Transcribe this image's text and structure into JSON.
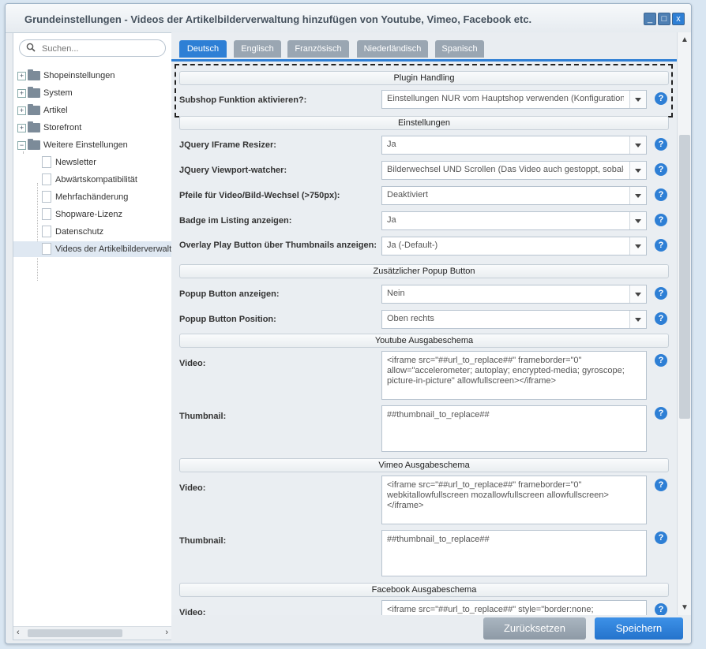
{
  "window": {
    "title": "Grundeinstellungen - Videos der Artikelbilderverwaltung hinzufügen von Youtube, Vimeo, Facebook etc.",
    "controls": {
      "minimize": "_",
      "maximize": "□",
      "close": "x"
    }
  },
  "sidebar": {
    "search_placeholder": "Suchen...",
    "tree": [
      {
        "label": "Shopeinstellungen",
        "type": "folder"
      },
      {
        "label": "System",
        "type": "folder"
      },
      {
        "label": "Artikel",
        "type": "folder"
      },
      {
        "label": "Storefront",
        "type": "folder"
      },
      {
        "label": "Weitere Einstellungen",
        "type": "folder-open"
      },
      {
        "label": "Newsletter",
        "type": "leaf"
      },
      {
        "label": "Abwärtskompatibilität",
        "type": "leaf"
      },
      {
        "label": "Mehrfachänderung",
        "type": "leaf"
      },
      {
        "label": "Shopware-Lizenz",
        "type": "leaf"
      },
      {
        "label": "Datenschutz",
        "type": "leaf"
      },
      {
        "label": "Videos der Artikelbilderverwaltung hinzufügen",
        "type": "leaf",
        "selected": true
      }
    ]
  },
  "tabs": [
    "Deutsch",
    "Englisch",
    "Französisch",
    "Niederländisch",
    "Spanisch"
  ],
  "form": {
    "sections": {
      "plugin_handling": "Plugin Handling",
      "settings": "Einstellungen",
      "popup": "Zusätzlicher Popup Button",
      "youtube": "Youtube Ausgabeschema",
      "vimeo": "Vimeo Ausgabeschema",
      "facebook": "Facebook Ausgabeschema"
    },
    "fields": {
      "subshop": {
        "label": "Subshop Funktion aktivieren?:",
        "value": "Einstellungen NUR vom Hauptshop verwenden (Konfigurationen"
      },
      "iframe_resizer": {
        "label": "JQuery IFrame Resizer:",
        "value": "Ja"
      },
      "viewport_watcher": {
        "label": "JQuery Viewport-watcher:",
        "value": "Bilderwechsel UND Scrollen (Das Video auch gestoppt, sobald"
      },
      "arrows": {
        "label": "Pfeile für Video/Bild-Wechsel (>750px):",
        "value": "Deaktiviert"
      },
      "badge": {
        "label": "Badge im Listing anzeigen:",
        "value": "Ja"
      },
      "overlay": {
        "label": "Overlay Play Button über Thumbnails anzeigen:",
        "value": "Ja (-Default-)"
      },
      "popup_show": {
        "label": "Popup Button anzeigen:",
        "value": "Nein"
      },
      "popup_pos": {
        "label": "Popup Button Position:",
        "value": "Oben rechts"
      },
      "yt_video": {
        "label": "Video:",
        "value": "<iframe src=\"##url_to_replace##\" frameborder=\"0\" allow=\"accelerometer; autoplay; encrypted-media; gyroscope; picture-in-picture\" allowfullscreen></iframe>"
      },
      "yt_thumb": {
        "label": "Thumbnail:",
        "value": "##thumbnail_to_replace##"
      },
      "vm_video": {
        "label": "Video:",
        "value": "<iframe src=\"##url_to_replace##\" frameborder=\"0\" webkitallowfullscreen mozallowfullscreen allowfullscreen></iframe>"
      },
      "vm_thumb": {
        "label": "Thumbnail:",
        "value": "##thumbnail_to_replace##"
      },
      "fb_video": {
        "label": "Video:",
        "value": "<iframe src=\"##url_to_replace##\" style=\"border:none;"
      }
    },
    "help_glyph": "?"
  },
  "footer": {
    "reset": "Zurücksetzen",
    "save": "Speichern"
  },
  "colors": {
    "accent": "#2e7fd5",
    "tab_inactive": "#9aa6b2"
  }
}
